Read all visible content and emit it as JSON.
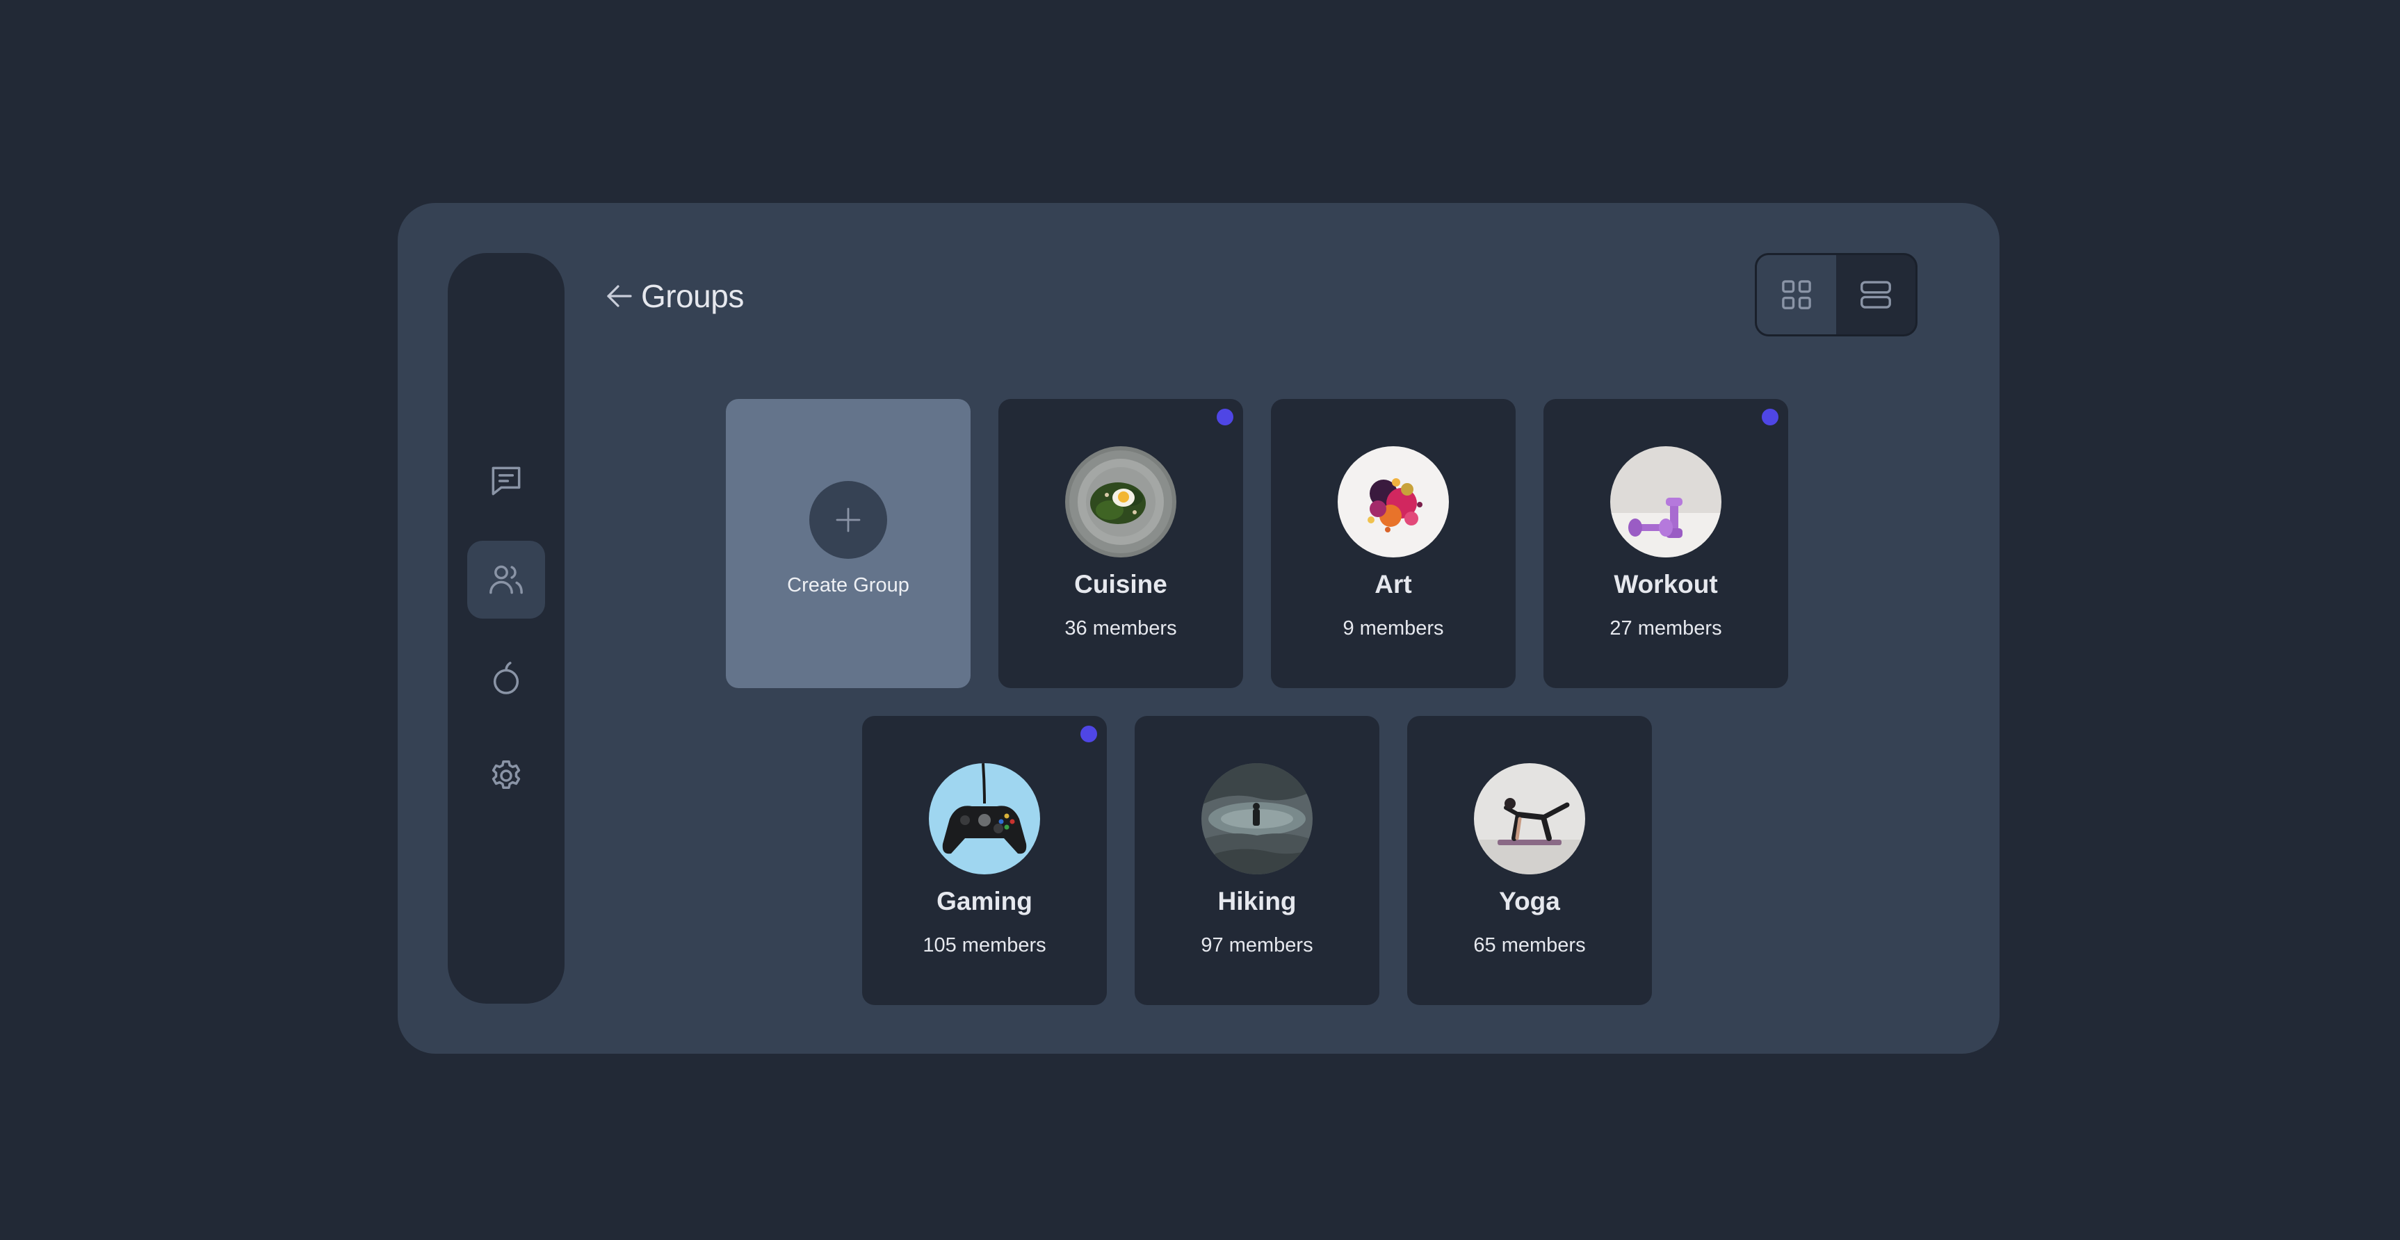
{
  "header": {
    "title": "Groups",
    "back_icon": "arrow-left-icon"
  },
  "sidebar": {
    "items": [
      {
        "icon": "chat-icon",
        "active": false
      },
      {
        "icon": "users-icon",
        "active": true
      },
      {
        "icon": "apple-icon",
        "active": false
      },
      {
        "icon": "gear-icon",
        "active": false
      }
    ]
  },
  "view_toggle": {
    "options": [
      {
        "icon": "grid-view-icon",
        "active": true
      },
      {
        "icon": "list-view-icon",
        "active": false
      }
    ]
  },
  "create_group": {
    "label": "Create Group",
    "icon": "plus-icon"
  },
  "groups": [
    {
      "name": "Cuisine",
      "members": "36 members",
      "unread": true
    },
    {
      "name": "Art",
      "members": "9 members",
      "unread": false
    },
    {
      "name": "Workout",
      "members": "27 members",
      "unread": true
    },
    {
      "name": "Gaming",
      "members": "105 members",
      "unread": true
    },
    {
      "name": "Hiking",
      "members": "97 members",
      "unread": false
    },
    {
      "name": "Yoga",
      "members": "65 members",
      "unread": false
    }
  ],
  "colors": {
    "background": "#222936",
    "panel": "#364254",
    "create_card": "#64748b",
    "unread_dot": "#4f46e5",
    "text": "#e6e8ee",
    "icon": "#8a94a6"
  }
}
